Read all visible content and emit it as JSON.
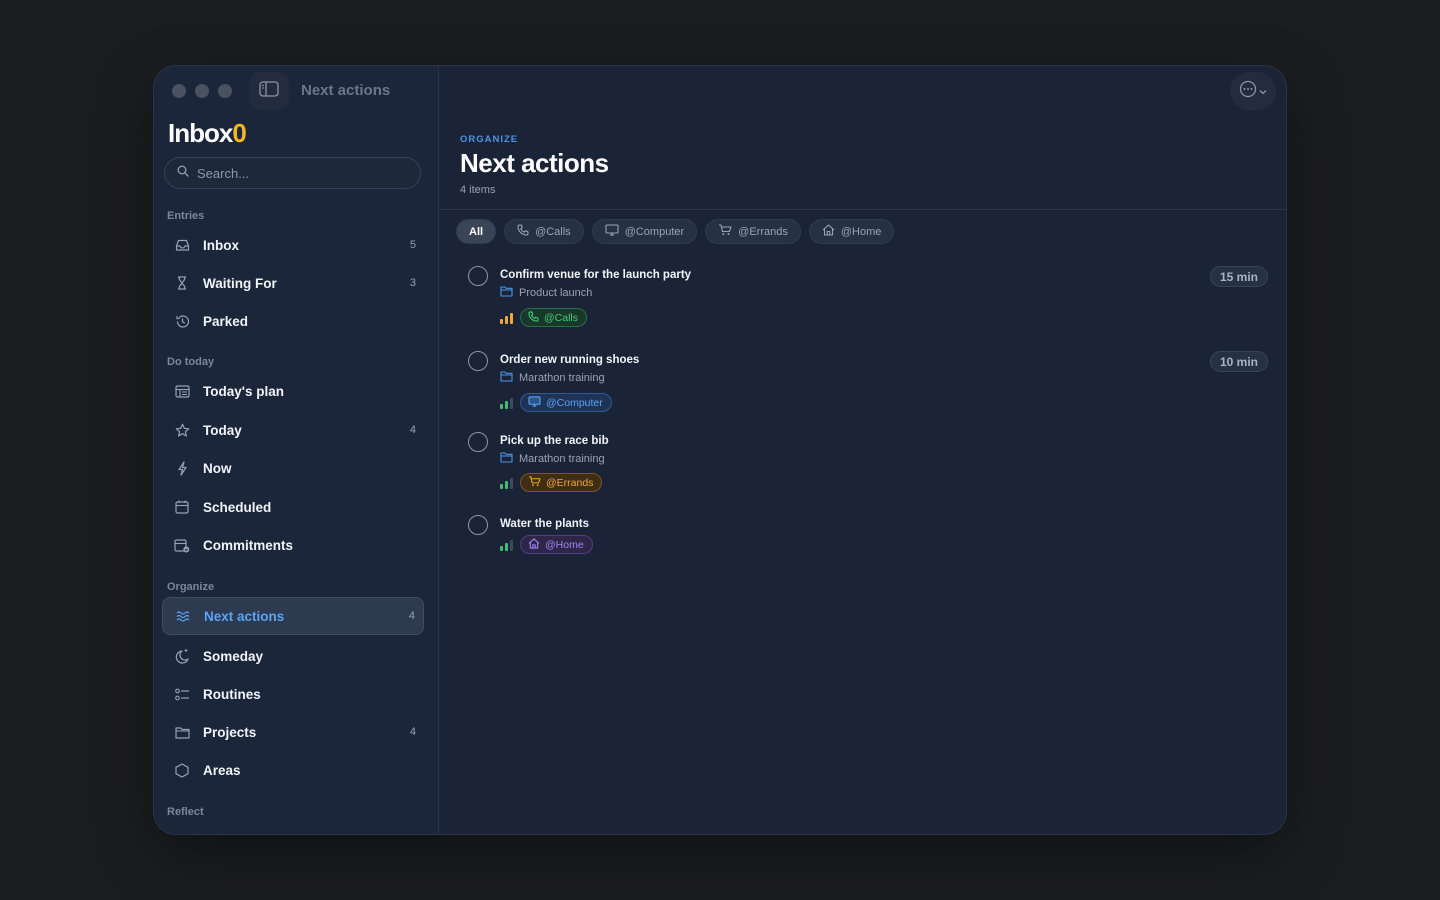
{
  "window": {
    "title": "Next actions"
  },
  "app": {
    "logo_main": "Inbox",
    "logo_accent": "0"
  },
  "search": {
    "placeholder": "Search..."
  },
  "sidebar": {
    "sections": [
      {
        "label": "Entries"
      },
      {
        "label": "Do today"
      },
      {
        "label": "Organize"
      },
      {
        "label": "Reflect"
      }
    ],
    "items": [
      {
        "label": "Inbox",
        "count": "5",
        "icon": "inbox-icon"
      },
      {
        "label": "Waiting For",
        "count": "3",
        "icon": "hourglass-icon"
      },
      {
        "label": "Parked",
        "count": "",
        "icon": "history-icon"
      },
      {
        "label": "Today's plan",
        "count": "",
        "icon": "plan-icon"
      },
      {
        "label": "Today",
        "count": "4",
        "icon": "star-icon"
      },
      {
        "label": "Now",
        "count": "",
        "icon": "bolt-icon"
      },
      {
        "label": "Scheduled",
        "count": "",
        "icon": "calendar-icon"
      },
      {
        "label": "Commitments",
        "count": "",
        "icon": "calendar-check-icon"
      },
      {
        "label": "Next actions",
        "count": "4",
        "icon": "waves-icon",
        "active": true
      },
      {
        "label": "Someday",
        "count": "",
        "icon": "moon-icon"
      },
      {
        "label": "Routines",
        "count": "",
        "icon": "checklist-icon"
      },
      {
        "label": "Projects",
        "count": "4",
        "icon": "folder-icon"
      },
      {
        "label": "Areas",
        "count": "",
        "icon": "hexagon-icon"
      }
    ]
  },
  "main": {
    "eyebrow": "ORGANIZE",
    "title": "Next actions",
    "count": "4 items",
    "filters": [
      {
        "label": "All",
        "icon": "",
        "active": true
      },
      {
        "label": "@Calls",
        "icon": "phone-icon"
      },
      {
        "label": "@Computer",
        "icon": "monitor-icon"
      },
      {
        "label": "@Errands",
        "icon": "cart-icon"
      },
      {
        "label": "@Home",
        "icon": "house-icon"
      }
    ],
    "tasks": [
      {
        "title": "Confirm venue for the launch party",
        "project": "Product launch",
        "tag": "@Calls",
        "tag_color": "#45c97a",
        "duration": "15 min",
        "energy_level": 3,
        "energy_color": "#f2a53a"
      },
      {
        "title": "Order new running shoes",
        "project": "Marathon training",
        "tag": "@Computer",
        "tag_color": "#5ba3f8",
        "duration": "10 min",
        "energy_level": 2,
        "energy_color": "#3fbf6e"
      },
      {
        "title": "Pick up the race bib",
        "project": "Marathon training",
        "tag": "@Errands",
        "tag_color": "#f2a53a",
        "duration": "",
        "energy_level": 2,
        "energy_color": "#3fbf6e"
      },
      {
        "title": "Water the plants",
        "project": "",
        "tag": "@Home",
        "tag_color": "#a184f3",
        "duration": "",
        "energy_level": 2,
        "energy_color": "#3fbf6e"
      }
    ]
  },
  "colors": {
    "accent": "#4f93e6",
    "logo_accent": "#f5b623",
    "background": "#1a2436"
  }
}
